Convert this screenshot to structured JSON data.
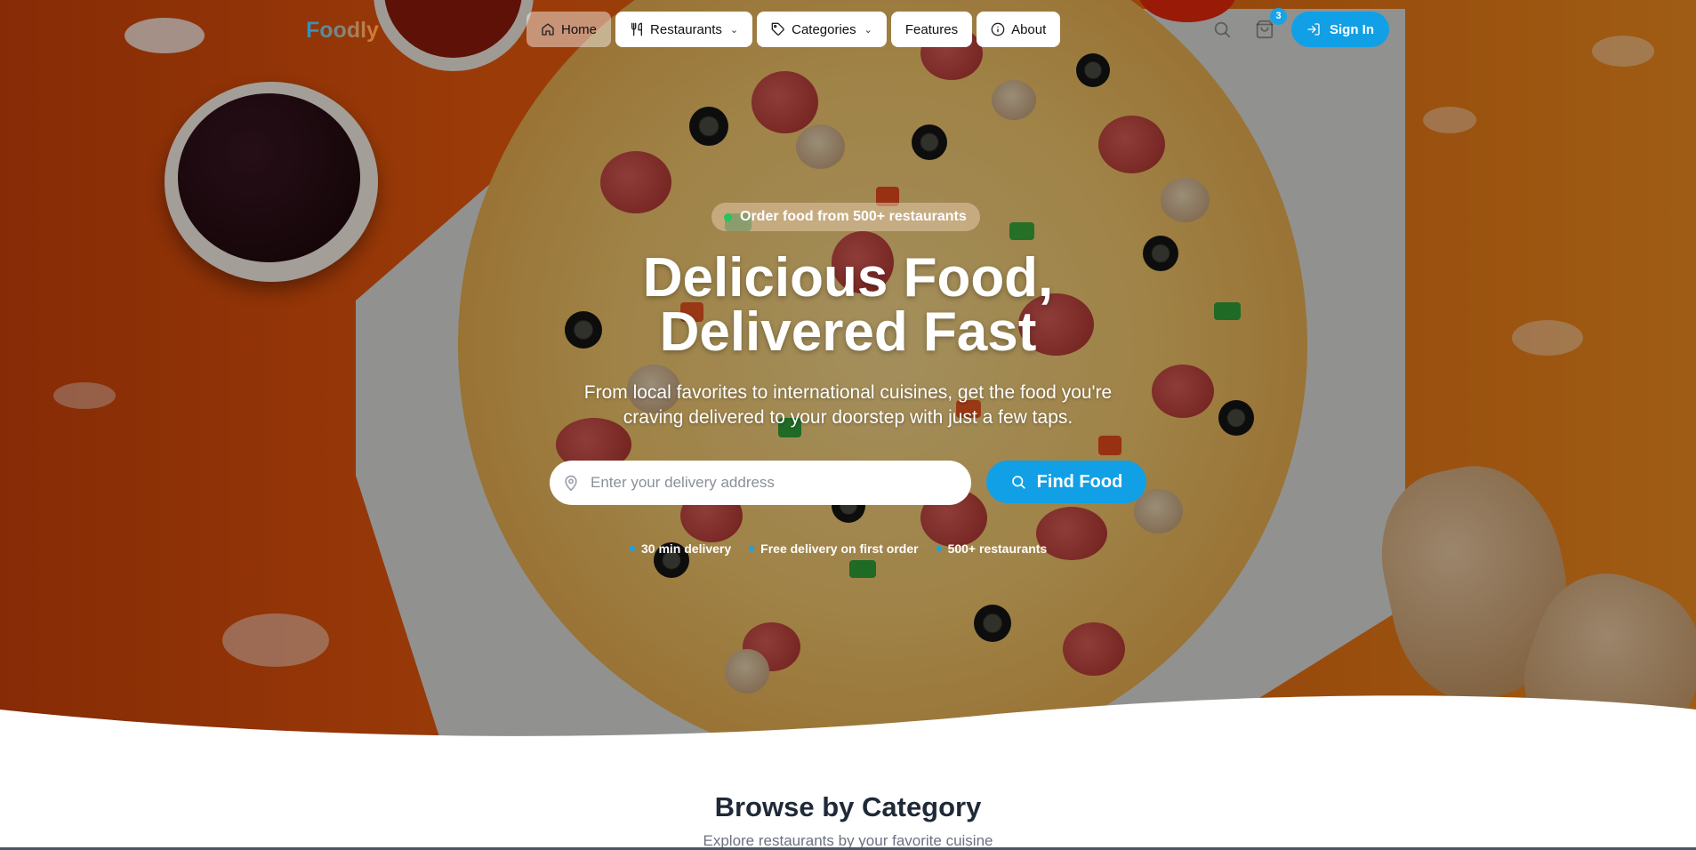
{
  "brand": {
    "logo": "Foodly"
  },
  "nav": {
    "items": [
      {
        "label": "Home",
        "icon": "home-icon"
      },
      {
        "label": "Restaurants",
        "icon": "utensils-icon"
      },
      {
        "label": "Categories",
        "icon": "tag-icon"
      },
      {
        "label": "Features"
      },
      {
        "label": "About",
        "icon": "info-icon"
      }
    ],
    "cart_count": "3",
    "sign_in": "Sign In"
  },
  "hero": {
    "pill": "Order food from 500+ restaurants",
    "headline_line1": "Delicious Food,",
    "headline_line2": "Delivered Fast",
    "subtitle": "From local favorites to international cuisines, get the food you're craving delivered to your doorstep with just a few taps.",
    "address_placeholder": "Enter your delivery address",
    "find_button": "Find Food",
    "features": [
      "30 min delivery",
      "Free delivery on first order",
      "500+ restaurants"
    ]
  },
  "browse": {
    "title": "Browse by Category",
    "subtitle": "Explore restaurants by your favorite cuisine"
  },
  "colors": {
    "accent": "#11a0e5",
    "hero_orange": "#e8590c",
    "status_green": "#22c55e"
  }
}
